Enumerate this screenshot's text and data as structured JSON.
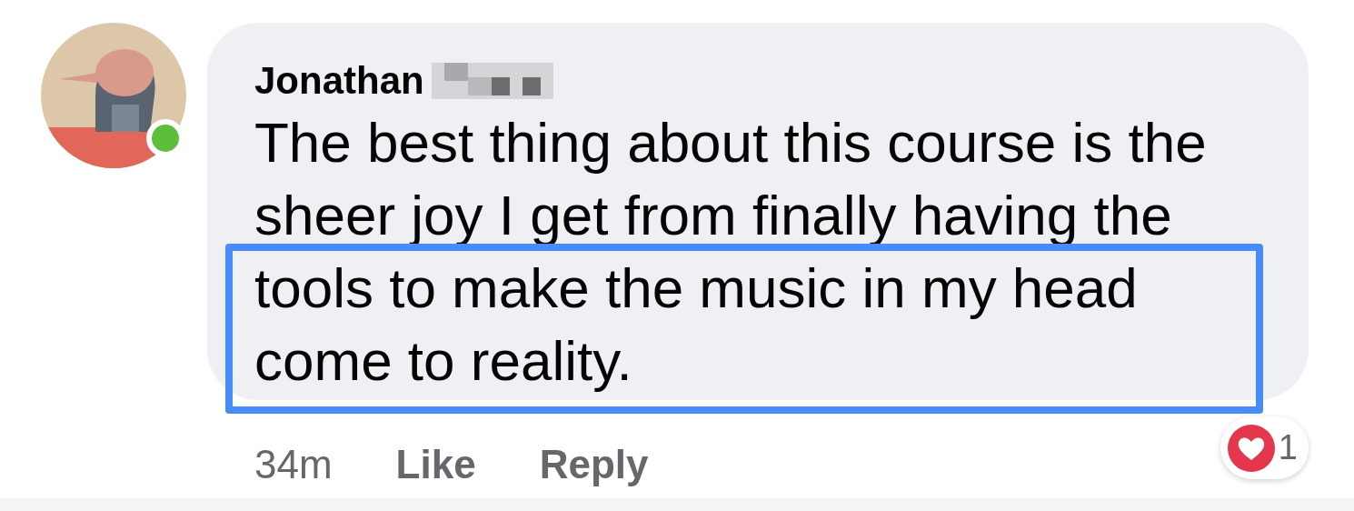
{
  "comment": {
    "author": "Jonathan",
    "online": true,
    "text": "The best thing about this course is the sheer joy I get from finally having the tools to make the music in my head come to reality.",
    "highlighted": true,
    "time": "34m",
    "actions": [
      "Like",
      "Reply"
    ],
    "reaction": {
      "count": "1"
    }
  }
}
